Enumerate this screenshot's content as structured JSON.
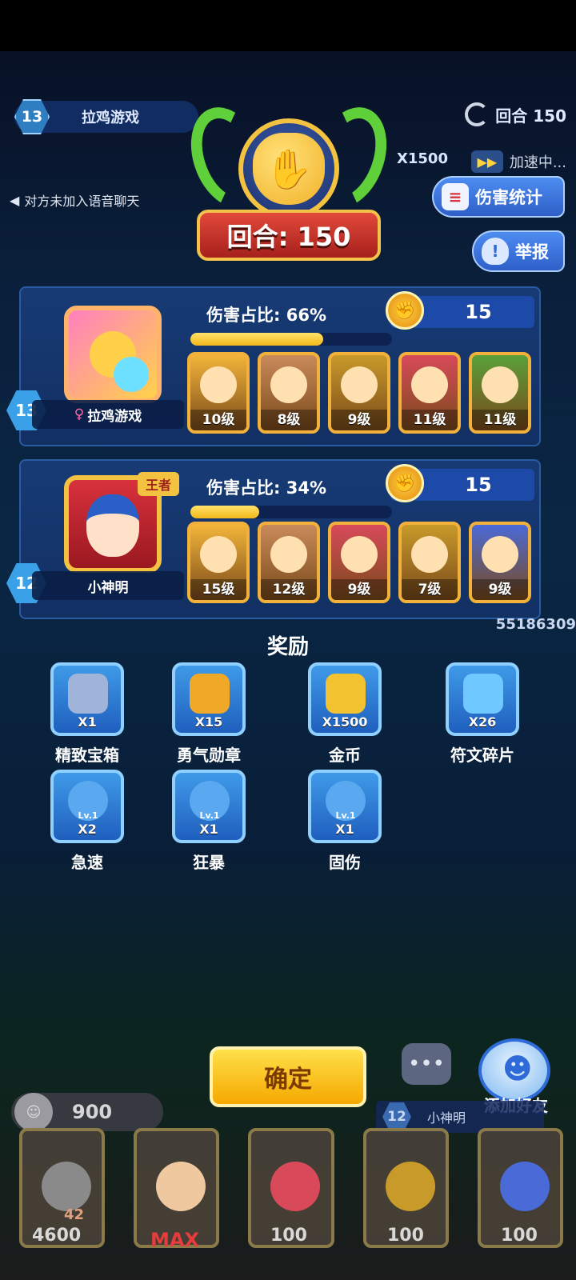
{
  "hud": {
    "player_level": "13",
    "player_name": "拉鸡游戏",
    "round_text": "回合 150",
    "gold_text": "X1500",
    "speed_text": "加速中...",
    "voice_text": "对方未加入语音聊天",
    "damage_stats_button": "伤害统计",
    "report_button": "举报"
  },
  "result": {
    "round_banner": "回合: 150"
  },
  "players": [
    {
      "level": "13",
      "name": "拉鸡游戏",
      "gender_symbol": "♀",
      "damage_label": "伤害占比:",
      "damage_value": "66%",
      "damage_fraction": 0.66,
      "medals": "15",
      "heroes": [
        {
          "level": "10级",
          "color": "#f3b53a"
        },
        {
          "level": "8级",
          "color": "#c98a5a"
        },
        {
          "level": "9级",
          "color": "#c89a2a"
        },
        {
          "level": "11级",
          "color": "#d84a5a"
        },
        {
          "level": "11级",
          "color": "#5aa03a"
        }
      ]
    },
    {
      "level": "12",
      "name": "小神明",
      "crown_tag": "王者",
      "damage_label": "伤害占比:",
      "damage_value": "34%",
      "damage_fraction": 0.34,
      "medals": "15",
      "heroes": [
        {
          "level": "15级",
          "color": "#f3b53a"
        },
        {
          "level": "12级",
          "color": "#c98a5a"
        },
        {
          "level": "9级",
          "color": "#d84a5a"
        },
        {
          "level": "7级",
          "color": "#c89a2a"
        },
        {
          "level": "9级",
          "color": "#4a6ad8"
        }
      ]
    }
  ],
  "side_score": "55186309",
  "rewards": {
    "title": "奖励",
    "items": [
      {
        "name": "精致宝箱",
        "qty": "X1",
        "icon": "chest-icon",
        "color": "#9fb4d8"
      },
      {
        "name": "勇气勋章",
        "qty": "X15",
        "icon": "medal-icon",
        "color": "#f0a828"
      },
      {
        "name": "金币",
        "qty": "X1500",
        "icon": "coin-icon",
        "color": "#f2c230"
      },
      {
        "name": "符文碎片",
        "qty": "X26",
        "icon": "crystal-icon",
        "color": "#6fc8ff"
      },
      {
        "name": "急速",
        "qty": "X2",
        "icon": "rune-lv1-icon",
        "color": "#5aa8f0"
      },
      {
        "name": "狂暴",
        "qty": "X1",
        "icon": "rune-lv1-icon",
        "color": "#5aa8f0"
      },
      {
        "name": "固伤",
        "qty": "X1",
        "icon": "rune-lv1-icon",
        "color": "#5aa8f0"
      }
    ],
    "rune_level_text": "Lv.1"
  },
  "bottom": {
    "confirm_button": "确定",
    "chat_icon_text": "•••",
    "add_friend_label": "添加好友",
    "energy_value": "900",
    "opponent_level": "12",
    "opponent_name": "小神明",
    "hero_level_badge": "42",
    "max_label": "MAX",
    "card_costs": [
      "4600",
      "100",
      "100",
      "100"
    ]
  }
}
